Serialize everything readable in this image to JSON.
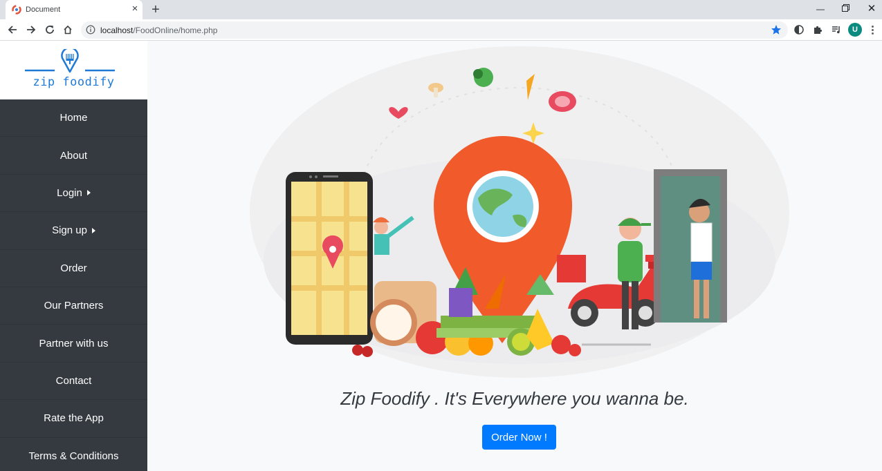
{
  "browser": {
    "tab_title": "Document",
    "url_host": "localhost",
    "url_path": "/FoodOnline/home.php",
    "avatar_letter": "U"
  },
  "logo": {
    "text": "zip foodify",
    "color": "#1e7ad6"
  },
  "sidebar": {
    "items": [
      {
        "label": "Home",
        "caret": false
      },
      {
        "label": "About",
        "caret": false
      },
      {
        "label": "Login",
        "caret": true
      },
      {
        "label": "Sign up",
        "caret": true
      },
      {
        "label": "Order",
        "caret": false
      },
      {
        "label": "Our Partners",
        "caret": false
      },
      {
        "label": "Partner with us",
        "caret": false
      },
      {
        "label": "Contact",
        "caret": false
      },
      {
        "label": "Rate the App",
        "caret": false
      },
      {
        "label": "Terms & Conditions",
        "caret": false
      }
    ]
  },
  "main": {
    "tagline": "Zip Foodify . It's Everywhere you wanna be.",
    "order_button": "Order Now !"
  },
  "colors": {
    "sidebar_bg": "#343a40",
    "accent": "#007bff",
    "pin": "#f15a2b"
  },
  "icons": [
    "back-arrow-icon",
    "forward-arrow-icon",
    "reload-icon",
    "home-icon",
    "info-icon",
    "star-icon",
    "dark-mode-icon",
    "extensions-icon",
    "media-icon",
    "menu-icon"
  ]
}
